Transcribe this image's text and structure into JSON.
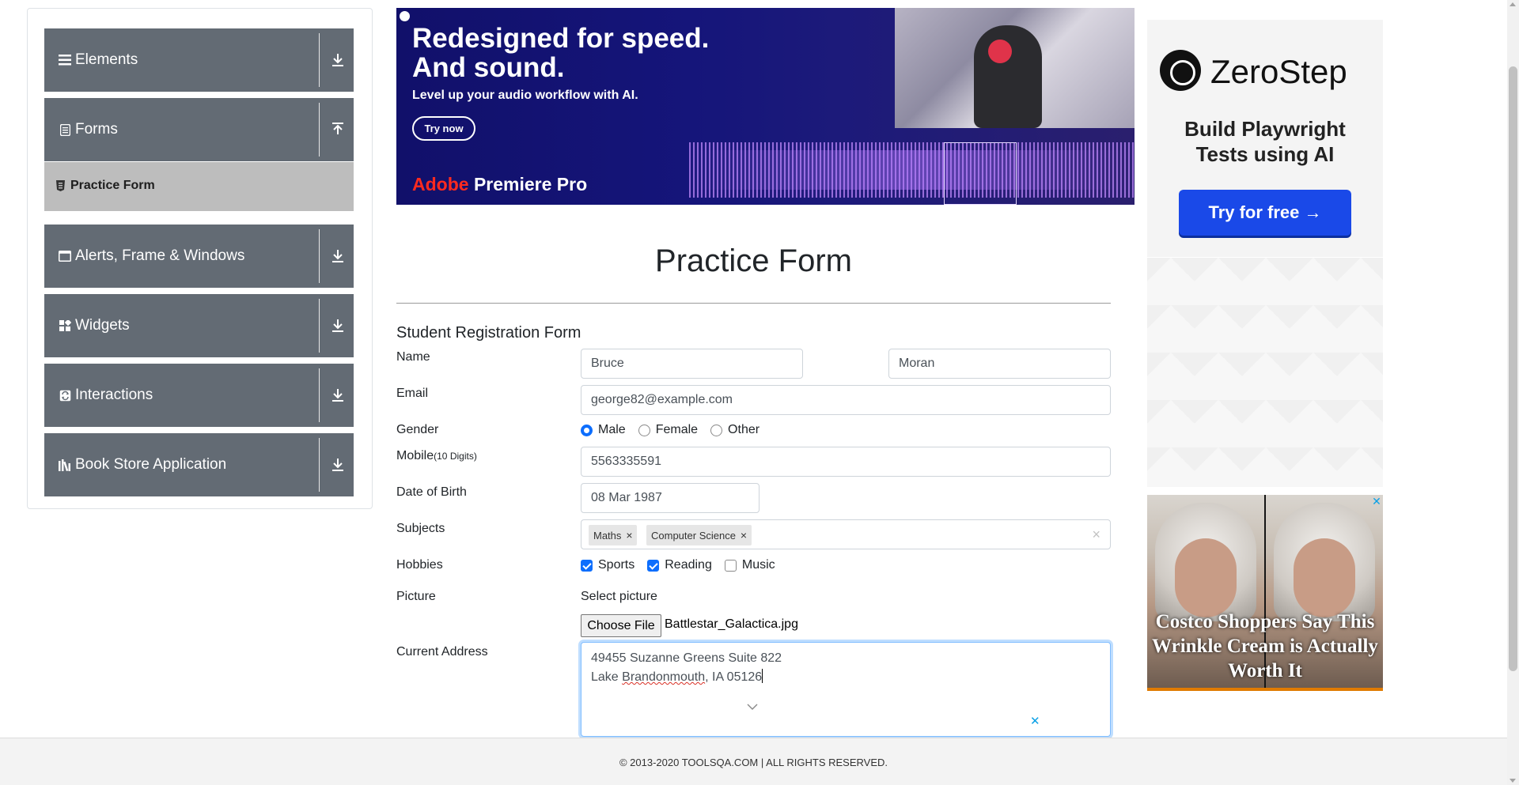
{
  "sidebar": {
    "groups": [
      {
        "label": "Elements",
        "icon": "hamburger-icon",
        "arrow": "download-icon"
      },
      {
        "label": "Forms",
        "icon": "document-icon",
        "arrow": "upload-icon"
      },
      {
        "label": "Alerts, Frame & Windows",
        "icon": "window-icon",
        "arrow": "download-icon"
      },
      {
        "label": "Widgets",
        "icon": "widgets-icon",
        "arrow": "download-icon"
      },
      {
        "label": "Interactions",
        "icon": "interactions-icon",
        "arrow": "download-icon"
      },
      {
        "label": "Book Store Application",
        "icon": "books-icon",
        "arrow": "download-icon"
      }
    ],
    "active_item": {
      "label": "Practice Form",
      "icon": "html5-icon"
    }
  },
  "ads": {
    "top": {
      "headline_1": "Redesigned for speed.",
      "headline_2": "And sound.",
      "subline": "Level up your audio workflow with AI.",
      "cta": "Try now",
      "brand_1": "Adobe",
      "brand_2": " Premiere Pro"
    },
    "zerostep": {
      "brand": "ZeroStep",
      "line_1": "Build Playwright",
      "line_2": "Tests using AI",
      "cta": "Try for free →"
    },
    "costco": {
      "caption": "Costco Shoppers Say This Wrinkle Cream is Actually Worth It"
    },
    "close_glyph": "✕"
  },
  "form": {
    "page_title": "Practice Form",
    "heading": "Student Registration Form",
    "labels": {
      "name": "Name",
      "email": "Email",
      "gender": "Gender",
      "mobile": "Mobile",
      "mobile_hint": "(10 Digits)",
      "dob": "Date of Birth",
      "subjects": "Subjects",
      "hobbies": "Hobbies",
      "picture": "Picture",
      "address": "Current Address"
    },
    "first_name": "Bruce",
    "last_name": "Moran",
    "email": "george82@example.com",
    "gender_options": [
      {
        "label": "Male",
        "selected": true
      },
      {
        "label": "Female",
        "selected": false
      },
      {
        "label": "Other",
        "selected": false
      }
    ],
    "mobile": "5563335591",
    "dob": "08 Mar 1987",
    "subjects": [
      "Maths",
      "Computer Science"
    ],
    "chip_remove": "×",
    "subjects_clear": "×",
    "hobbies": [
      {
        "label": "Sports",
        "checked": true
      },
      {
        "label": "Reading",
        "checked": true
      },
      {
        "label": "Music",
        "checked": false
      }
    ],
    "picture_prompt": "Select picture",
    "file_button": "Choose File",
    "file_name": "Battlestar_Galactica.jpg",
    "address_line_1": "49455 Suzanne Greens Suite 822",
    "address_line_2_a": "Lake ",
    "address_line_2_b": "Brandonmouth",
    "address_line_2_c": ", IA 05126"
  },
  "footer": {
    "text": "© 2013-2020 TOOLSQA.COM | ALL RIGHTS RESERVED."
  },
  "colors": {
    "sidebar_group": "#636b74",
    "sidebar_active": "#bdbdbd",
    "accent": "#0d6efd",
    "ad_top_bg": "#11106a",
    "zerostep_cta": "#1a49e8"
  }
}
